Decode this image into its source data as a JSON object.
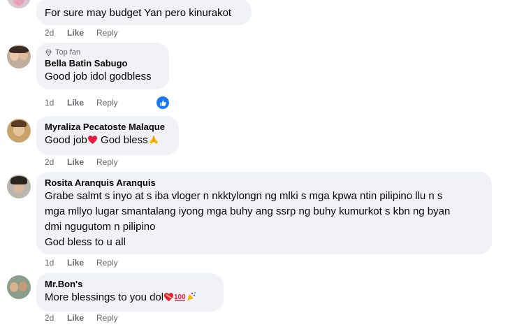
{
  "comments": [
    {
      "name": "",
      "text": "For sure may budget Yan pero kinurakot",
      "time": "2d",
      "like": "Like",
      "reply": "Reply"
    },
    {
      "badge": "Top fan",
      "name": "Bella Batin Sabugo",
      "text": "Good job idol godbless",
      "time": "1d",
      "like": "Like",
      "reply": "Reply",
      "reaction": "like-reaction"
    },
    {
      "name": "Myraliza Pecatoste Malaque",
      "text_parts": [
        "Good job",
        " God bless"
      ],
      "time": "2d",
      "like": "Like",
      "reply": "Reply"
    },
    {
      "name": "Rosita Aranquis Aranquis",
      "text": "Grabe salmt s inyo at s iba vloger n nkktylongn ng mlki s mga kpwa ntin pilipino llu n s\nmga mllyo lugar smantalang iyong mga buhy ang ssrp ng buhy kumurkot s kbn ng byan\ndmi ngugutom n pilipino\nGod bless to u all",
      "time": "1d",
      "like": "Like",
      "reply": "Reply"
    },
    {
      "name": "Mr.Bon's",
      "text": "More blessings to you dol",
      "time": "2d",
      "like": "Like",
      "reply": "Reply"
    }
  ],
  "colors": {
    "bubble": "#f0f2f5",
    "meta": "#65676b",
    "like_blue": "#1877f2",
    "heart_red": "#e41e3f"
  }
}
